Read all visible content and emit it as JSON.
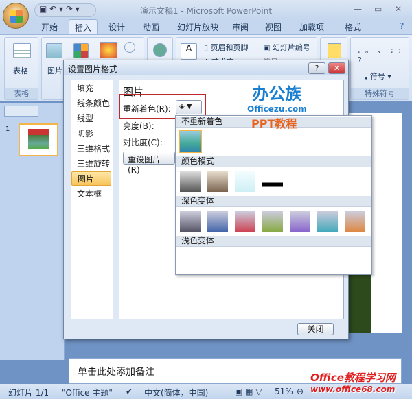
{
  "window": {
    "title": "演示文稿1 - Microsoft PowerPoint",
    "qat": "▣ ↶ ▾ ↷ ▾"
  },
  "tabs": [
    {
      "label": "开始"
    },
    {
      "label": "插入"
    },
    {
      "label": "设计"
    },
    {
      "label": "动画"
    },
    {
      "label": "幻灯片放映"
    },
    {
      "label": "审阅"
    },
    {
      "label": "视图"
    },
    {
      "label": "加载项"
    },
    {
      "label": "格式"
    }
  ],
  "ribbon": {
    "table": "表格",
    "table_group": "表格",
    "picture": "图片",
    "header_footer": "页眉和页脚",
    "slide_number": "幻灯片编号",
    "wordart": "艺术字",
    "symbol_partial": "符号",
    "symbol": "符号",
    "special_group": "特殊符号",
    "punct": ", 。 、 ; : ?"
  },
  "dialog": {
    "title": "设置图片格式",
    "help": "?",
    "close_x": "✕",
    "nav": [
      "填充",
      "线条颜色",
      "线型",
      "阴影",
      "三维格式",
      "三维旋转",
      "图片",
      "文本框"
    ],
    "selected_nav": "图片",
    "section": "图片",
    "recolor": "重新着色(R):",
    "brightness": "亮度(B):",
    "contrast": "对比度(C):",
    "reset": "重设图片(R)",
    "close": "关闭"
  },
  "dropdown": {
    "sections": [
      "不重新着色",
      "颜色模式",
      "深色变体",
      "浅色变体"
    ]
  },
  "logo": {
    "brand": "办公族",
    "site": "Officezu.com",
    "sub": "PPT教程"
  },
  "notes": {
    "placeholder": "单击此处添加备注"
  },
  "status": {
    "slide": "幻灯片 1/1",
    "theme": "\"Office 主题\"",
    "lang": "中文(简体，中国)",
    "zoom": "51%"
  },
  "watermark": {
    "text": "Office教程学习网",
    "url": "www.office68.com"
  },
  "colors": {
    "accent": "#f8c35a",
    "highlight_box": "#c0282d"
  }
}
